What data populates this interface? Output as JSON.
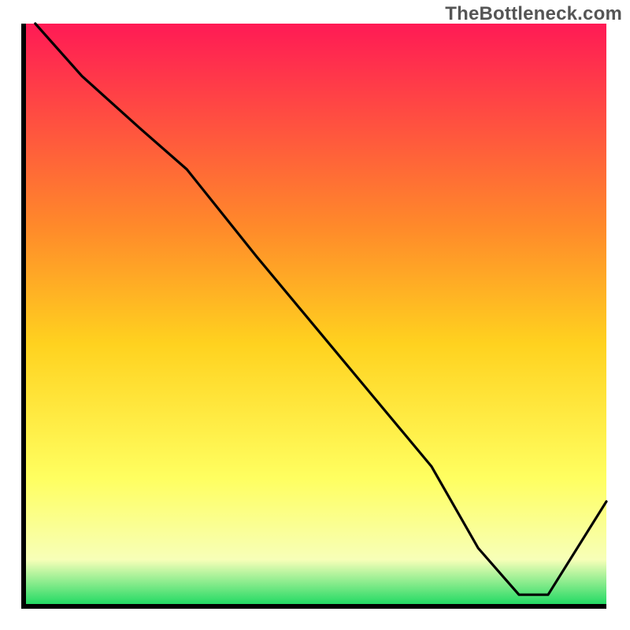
{
  "watermark": "TheBottleneck.com",
  "colors": {
    "gradient_top": "#ff1a55",
    "gradient_upper_mid": "#ff8a2a",
    "gradient_mid": "#ffd21f",
    "gradient_lower_mid": "#ffff60",
    "gradient_low": "#f7ffb8",
    "gradient_bottom": "#18d860",
    "line": "#000000",
    "axis": "#000000",
    "tick_label": "#d24a4a"
  },
  "chart_data": {
    "type": "line",
    "title": "",
    "xlabel": "",
    "ylabel": "",
    "xlim": [
      0,
      100
    ],
    "ylim": [
      0,
      100
    ],
    "x": [
      2,
      10,
      20,
      28,
      40,
      50,
      60,
      70,
      78,
      85,
      90,
      100
    ],
    "values": [
      100,
      91,
      82,
      75,
      60,
      48,
      36,
      24,
      10,
      2,
      2,
      18
    ],
    "annotation": {
      "x": 86,
      "y": 2,
      "label": ""
    }
  }
}
